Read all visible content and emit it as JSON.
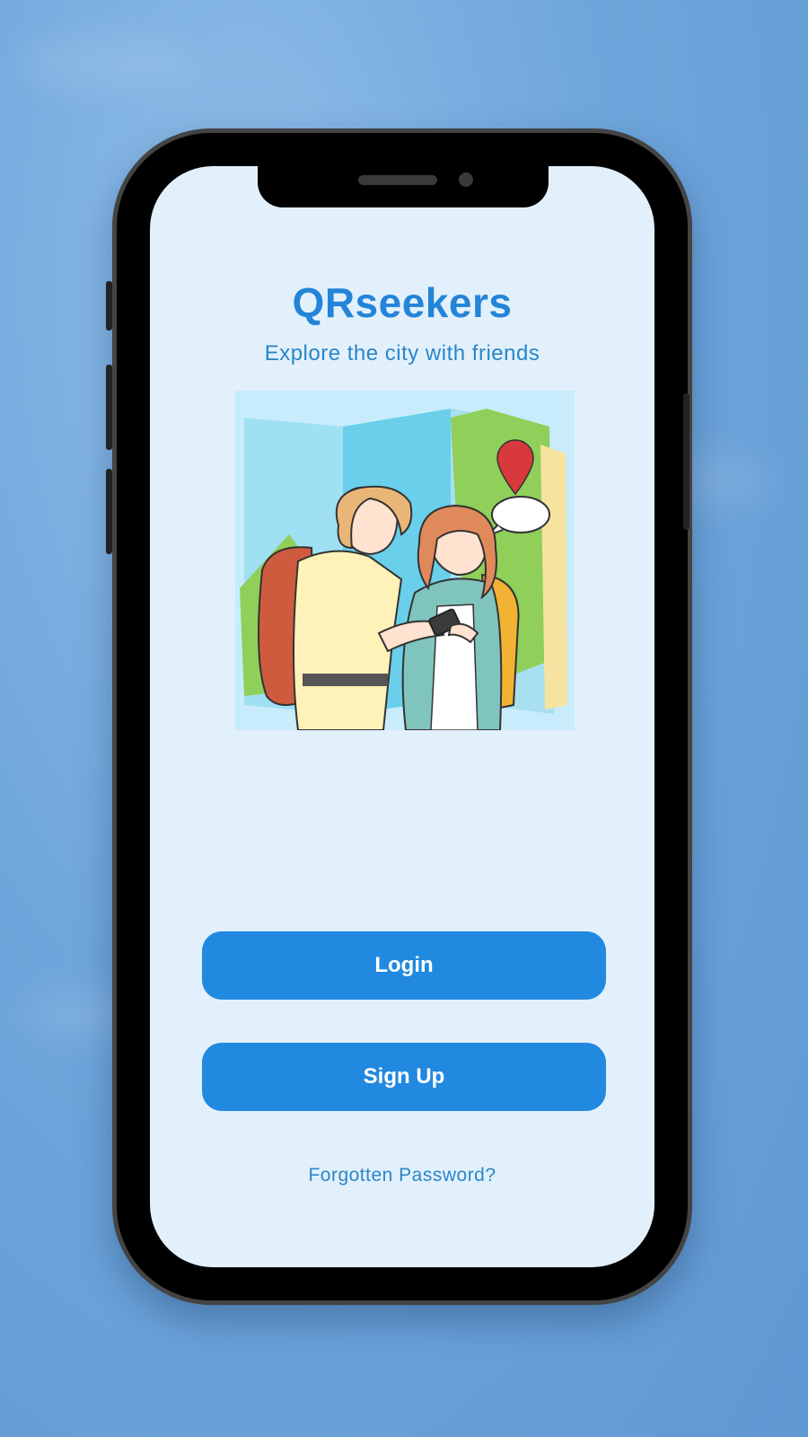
{
  "app": {
    "title": "QRseekers",
    "subtitle": "Explore the city with friends"
  },
  "illustration": {
    "icon": "travelers-with-map-illustration"
  },
  "buttons": {
    "login_label": "Login",
    "signup_label": "Sign Up"
  },
  "links": {
    "forgot_password": "Forgotten Password?"
  },
  "colors": {
    "accent": "#2189e0",
    "title": "#2384d8",
    "screen_bg": "#e2f0fc",
    "page_bg": "#6fa6dc"
  }
}
